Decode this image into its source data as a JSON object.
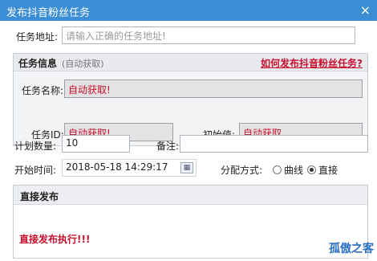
{
  "window": {
    "title": "发布抖音粉丝任务",
    "close_glyph": "×"
  },
  "form": {
    "task_address_label": "任务地址:",
    "task_address_placeholder": "请输入正确的任务地址!",
    "info": {
      "title": "任务信息",
      "subtitle": "(自动获取)",
      "help_link": "如何发布抖音粉丝任务?",
      "name_label": "任务名称:",
      "name_value": "自动获取!",
      "id_label": "任务ID:",
      "id_value": "自动获取!",
      "initial_label": "初始值:",
      "initial_value": "自动获取"
    },
    "quantity_label": "计划数量:",
    "quantity_value": "10",
    "remark_label": "备注:",
    "remark_value": "",
    "start_time_label": "开始时间:",
    "start_time_value": "2018-05-18 14:29:17",
    "mode_label": "分配方式:",
    "mode_options": [
      "曲线",
      "直接"
    ],
    "mode_selected": "直接"
  },
  "panel": {
    "title": "直接发布",
    "message": "直接发布执行!!!"
  },
  "watermark": "孤傲之客",
  "colors": {
    "titlebar": "#3c8ed4",
    "accent_red": "#c8102e"
  }
}
